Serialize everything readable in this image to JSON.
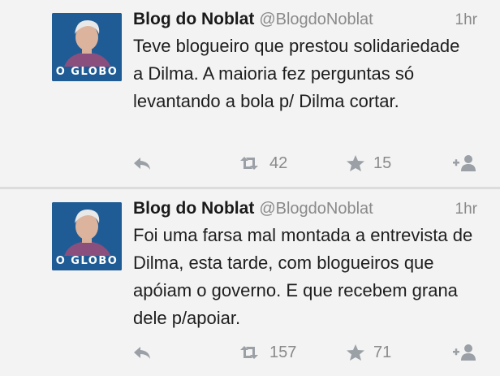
{
  "tweets": [
    {
      "avatar_brand": "O GLOBO",
      "name": "Blog do Noblat",
      "handle": "@BlogdoNoblat",
      "time": "1hr",
      "text": "Teve blogueiro que prestou solidariedade a Dilma. A maioria fez perguntas só levantando a bola p/ Dilma cortar.",
      "retweets": "42",
      "favorites": "15"
    },
    {
      "avatar_brand": "O GLOBO",
      "name": "Blog do Noblat",
      "handle": "@BlogdoNoblat",
      "time": "1hr",
      "text": "Foi uma farsa mal montada a entrevista de Dilma, esta tarde, com blogueiros que apóiam o governo. E que recebem grana dele p/apoiar.",
      "retweets": "157",
      "favorites": "71"
    }
  ],
  "colors": {
    "background": "#f3f3f3",
    "avatar_bg": "#1f5c95",
    "muted_text": "#8a8a8a",
    "icon": "#9aa0a6"
  }
}
